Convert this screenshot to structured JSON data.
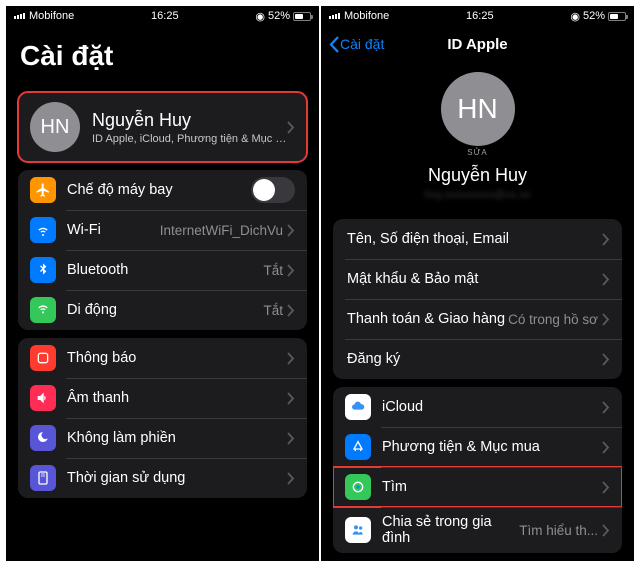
{
  "status": {
    "carrier": "Mobifone",
    "time": "16:25",
    "battery": "52%"
  },
  "initials": "HN",
  "left": {
    "title": "Cài đặt",
    "profile": {
      "name": "Nguyễn Huy",
      "subtitle": "ID Apple, iCloud, Phương tiện & Mục mua"
    },
    "rows": {
      "airplane": "Chế độ máy bay",
      "wifi": {
        "label": "Wi-Fi",
        "value": "InternetWiFi_DichVu"
      },
      "bluetooth": {
        "label": "Bluetooth",
        "value": "Tắt"
      },
      "cellular": {
        "label": "Di động",
        "value": "Tắt"
      },
      "notifications": "Thông báo",
      "sound": "Âm thanh",
      "dnd": "Không làm phiền",
      "screentime": "Thời gian sử dụng"
    }
  },
  "right": {
    "back": "Cài đặt",
    "title": "ID Apple",
    "edit": "SỬA",
    "name": "Nguyễn Huy",
    "rows": {
      "name_phone": "Tên, Số điện thoại, Email",
      "password": "Mật khẩu & Bảo mật",
      "payment": {
        "label": "Thanh toán & Giao hàng",
        "value": "Có trong hồ sơ"
      },
      "subs": "Đăng ký",
      "icloud": "iCloud",
      "media": "Phương tiện & Mục mua",
      "find": "Tìm",
      "family": {
        "label": "Chia sẻ trong gia đình",
        "value": "Tìm hiểu th..."
      }
    }
  }
}
